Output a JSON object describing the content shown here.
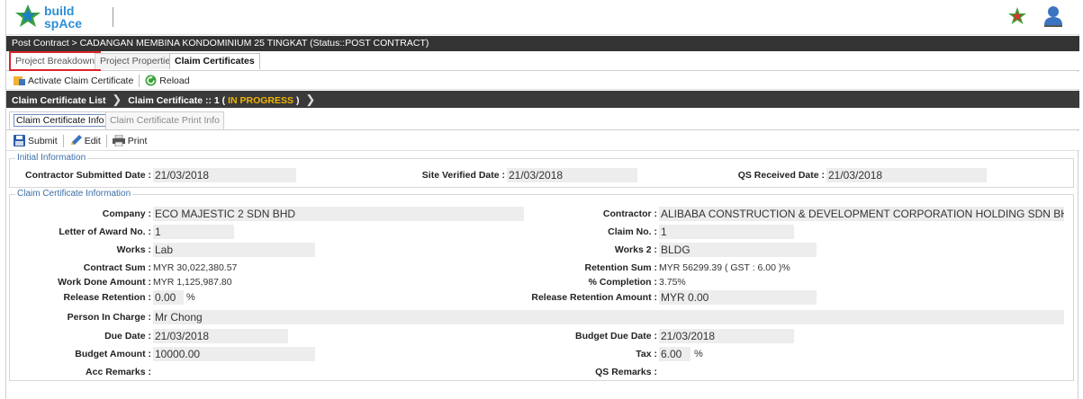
{
  "header": {
    "logo_text_top": "build",
    "logo_text_bottom": "space"
  },
  "breadcrumb": {
    "text": "Post Contract > CADANGAN MEMBINA KONDOMINIUM 25 TINGKAT (Status::POST CONTRACT)"
  },
  "main_tabs": [
    "Project Breakdown",
    "Project Properties",
    "Claim Certificates"
  ],
  "toolbar1": {
    "activate_label": "Activate Claim Certificate",
    "reload_label": "Reload"
  },
  "crumb2": {
    "list_label": "Claim Certificate List",
    "current_label": "Claim Certificate :: 1 (",
    "status": "IN PROGRESS",
    "close": ")"
  },
  "sub_tabs": [
    "Claim Certificate Info",
    "Claim Certificate Print Info"
  ],
  "toolbar2": {
    "submit_label": "Submit",
    "edit_label": "Edit",
    "print_label": "Print"
  },
  "initial_info": {
    "legend": "Initial Information",
    "contractor_submitted_label": "Contractor Submitted Date :",
    "contractor_submitted_value": "21/03/2018",
    "site_verified_label": "Site Verified Date :",
    "site_verified_value": "21/03/2018",
    "qs_received_label": "QS Received Date :",
    "qs_received_value": "21/03/2018"
  },
  "claim_info": {
    "legend": "Claim Certificate Information",
    "company_label": "Company :",
    "company_value": "ECO MAJESTIC 2 SDN BHD",
    "contractor_label": "Contractor :",
    "contractor_value": "ALIBABA CONSTRUCTION & DEVELOPMENT  CORPORATION HOLDING SDN BHD",
    "loa_label": "Letter of Award No. :",
    "loa_value": "1",
    "claim_no_label": "Claim No. :",
    "claim_no_value": "1",
    "works_label": "Works :",
    "works_value": "Lab",
    "works2_label": "Works 2 :",
    "works2_value": "BLDG",
    "contract_sum_label": "Contract Sum :",
    "contract_sum_value": "MYR 30,022,380.57",
    "retention_sum_label": "Retention Sum :",
    "retention_sum_value": "MYR 56299.39 ( GST : 6.00 )%",
    "work_done_label": "Work Done Amount :",
    "work_done_value": "MYR 1,125,987.80",
    "completion_label": "% Completion :",
    "completion_value": "3.75%",
    "release_retention_label": "Release Retention :",
    "release_retention_value": "0.00",
    "release_retention_unit": "%",
    "release_retention_amount_label": "Release Retention Amount :",
    "release_retention_amount_value": "MYR 0.00",
    "person_label": "Person In Charge :",
    "person_value": "Mr Chong",
    "due_date_label": "Due Date :",
    "due_date_value": "21/03/2018",
    "budget_due_date_label": "Budget Due Date :",
    "budget_due_date_value": "21/03/2018",
    "budget_amount_label": "Budget Amount :",
    "budget_amount_value": "10000.00",
    "tax_label": "Tax :",
    "tax_value": "6.00",
    "tax_unit": "%",
    "acc_remarks_label": "Acc Remarks :",
    "qs_remarks_label": "QS Remarks :"
  }
}
